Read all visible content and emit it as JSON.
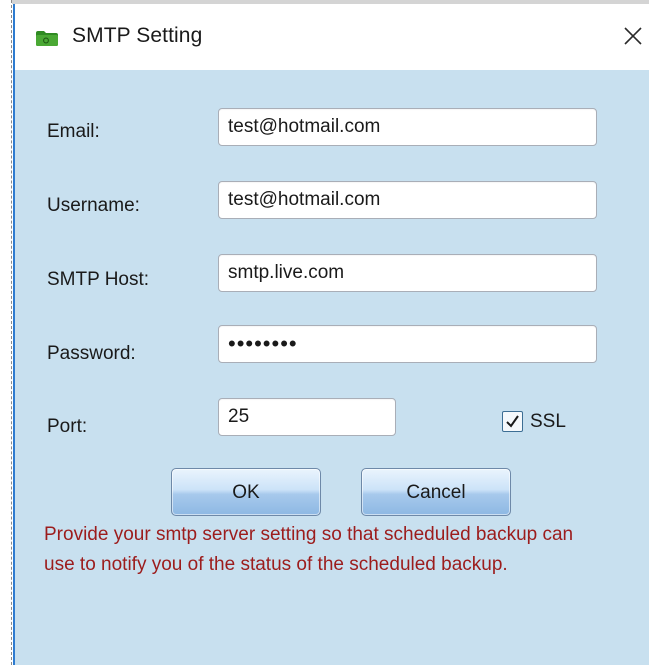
{
  "window": {
    "title": "SMTP Setting",
    "icon": "folder-icon",
    "close_icon": "close-icon"
  },
  "form": {
    "email": {
      "label": "Email:",
      "value": "test@hotmail.com"
    },
    "username": {
      "label": "Username:",
      "value": "test@hotmail.com"
    },
    "smtp_host": {
      "label": "SMTP Host:",
      "value": "smtp.live.com"
    },
    "password": {
      "label": "Password:",
      "value": "••••••••"
    },
    "port": {
      "label": "Port:",
      "value": "25"
    },
    "ssl": {
      "label": "SSL",
      "checked": true
    }
  },
  "buttons": {
    "ok_label": "OK",
    "cancel_label": "Cancel"
  },
  "message": "Provide your smtp server setting so that scheduled backup can use to notify you of the status of the scheduled backup.",
  "colors": {
    "background": "#c8e0ef",
    "message_text": "#9c1c1c",
    "folder_icon": "#3a9a2a",
    "window_border": "#2d7bd0"
  }
}
